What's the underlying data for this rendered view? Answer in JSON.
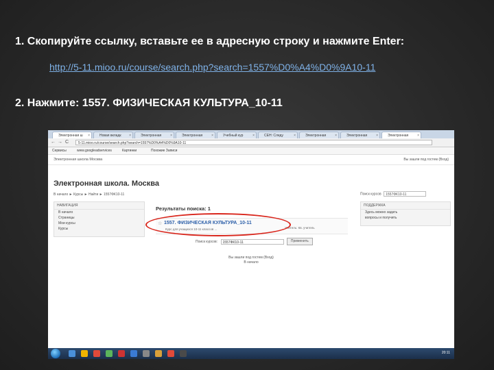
{
  "slide": {
    "line1": "1. Скопируйте ссылку, вставьте ее в адресную строку и нажмите Enter:",
    "link": "http://5-11.mioo.ru/course/search.php?search=1557%D0%A4%D0%9A10-11",
    "line2": "2. Нажмите: 1557. ФИЗИЧЕСКАЯ КУЛЬТУРА_10-11"
  },
  "browser": {
    "tabs": [
      {
        "label": "Электронная ш"
      },
      {
        "label": "Новая вкладк"
      },
      {
        "label": "Электронная"
      },
      {
        "label": "Электронная"
      },
      {
        "label": "Учебный кур"
      },
      {
        "label": "СЕН: Следу"
      },
      {
        "label": "Электронная"
      },
      {
        "label": "Электронная"
      },
      {
        "label": "Электронная"
      }
    ],
    "nav": {
      "back": "←",
      "forward": "→",
      "reload": "C"
    },
    "url": "5-11.mioo.ru/course/search.php?search=1557%D0%A4%D0%9A10-11",
    "bookmarks": [
      "Сервисы",
      "www.googleadservices",
      "Картинки",
      "Похожие Записи"
    ]
  },
  "site": {
    "top_left": "Электронная школа Москва",
    "top_right": "Вы зашли под гостем (Вход)",
    "title": "Электронная школа. Москва",
    "breadcrumbs": "В начало ► Курсы ► Найти ► 1557ФК10-11",
    "search_label": "Поиск курсов",
    "search_value": "1557ФК10-11",
    "nav_block": {
      "header": "НАВИГАЦИЯ",
      "items": [
        "В начало",
        "Страницы",
        "Мои курсы",
        "Курсы"
      ]
    },
    "support_block": {
      "header": "ПОДДЕРЖКА",
      "lines": [
        "Здесь можно задать",
        "вопросы и получить",
        "ответы"
      ]
    },
    "results_title": "Результаты поиска: 1",
    "course_name": "1557. ФИЗИЧЕСКАЯ КУЛЬТУРА_10-11",
    "course_desc": "Курс для учащихся 10-11 классов ...",
    "teacher_label": "Учитель:",
    "teacher_text": "Кв. учитель",
    "search2_label": "Поиск курсов:",
    "search2_value": "1557ФК10-11",
    "search2_button": "Применить",
    "footer_lines": [
      "Вы зашли под гостем (Вход)",
      "В начало"
    ]
  },
  "taskbar": {
    "clock": "20:11"
  },
  "colors": {
    "highlight": "#d9261c",
    "link": "#7fb2e8"
  }
}
